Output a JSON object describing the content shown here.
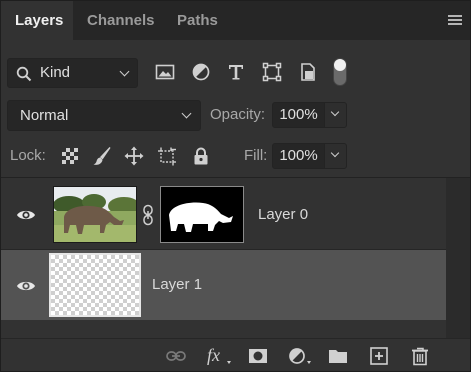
{
  "tabs": [
    {
      "label": "Layers",
      "active": true
    },
    {
      "label": "Channels",
      "active": false
    },
    {
      "label": "Paths",
      "active": false
    }
  ],
  "filter": {
    "kind_value": "Kind",
    "filter_icons": [
      "image-filter-icon",
      "adjustment-filter-icon",
      "type-filter-icon",
      "shape-filter-icon",
      "smart-object-filter-icon",
      "filter-toggle-icon"
    ]
  },
  "blend": {
    "mode": "Normal",
    "opacity_label": "Opacity:",
    "opacity_value": "100%"
  },
  "lock": {
    "label": "Lock:",
    "icons": [
      "lock-transparent-pixels-icon",
      "lock-image-pixels-icon",
      "lock-position-icon",
      "lock-artboard-icon",
      "lock-all-icon"
    ],
    "fill_label": "Fill:",
    "fill_value": "100%"
  },
  "layers": [
    {
      "name": "Layer 0",
      "visible": true,
      "has_mask": true,
      "selected": false
    },
    {
      "name": "Layer 1",
      "visible": true,
      "has_mask": false,
      "selected": true
    }
  ],
  "bottom_icons": [
    "link-layers-icon",
    "layer-style-icon",
    "add-mask-icon",
    "adjustment-layer-icon",
    "new-group-icon",
    "new-layer-icon",
    "delete-layer-icon"
  ],
  "colors": {
    "panel_bg": "#323232",
    "selected_row": "#535353",
    "tab_bar": "#262626"
  }
}
